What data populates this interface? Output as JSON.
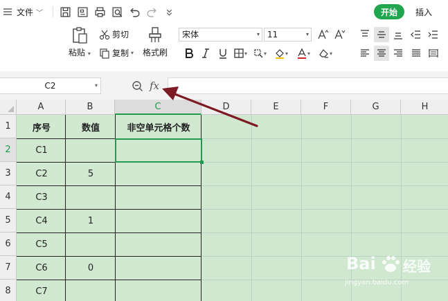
{
  "ribbon": {
    "file_menu_label": "文件",
    "tabs": {
      "start": "开始",
      "insert": "插入"
    },
    "clipboard": {
      "paste": "粘贴",
      "cut": "剪切",
      "copy": "复制",
      "format_painter": "格式刷"
    },
    "font": {
      "family": "宋体",
      "size": "11"
    },
    "quick_access_icons": [
      "save-icon",
      "export-pdf-icon",
      "print-icon",
      "print-preview-icon",
      "undo-icon",
      "redo-icon",
      "more-icon"
    ]
  },
  "formula_bar": {
    "name_box": "C2",
    "fx": "fx",
    "formula": ""
  },
  "sheet": {
    "columns": [
      "A",
      "B",
      "C",
      "D",
      "E",
      "F",
      "G",
      "H"
    ],
    "rows": [
      "1",
      "2",
      "3",
      "4",
      "5",
      "6",
      "7",
      "8"
    ],
    "selected_cell": "C2",
    "cells": {
      "A1": "序号",
      "B1": "数值",
      "C1": "非空单元格个数",
      "A2": "C1",
      "B2": "",
      "A3": "C2",
      "B3": "5",
      "A4": "C3",
      "B4": "",
      "A5": "C4",
      "B5": "1",
      "A6": "C5",
      "B6": "",
      "A7": "C6",
      "B7": "0",
      "A8": "C7",
      "B8": ""
    }
  },
  "colors": {
    "accent": "#1fa64f",
    "cell_fill": "#d0e9d0",
    "arrow": "#7d1a24"
  },
  "watermark": {
    "brand": "Bai",
    "brand2": "经验",
    "url": "jingyan.baidu.com"
  }
}
